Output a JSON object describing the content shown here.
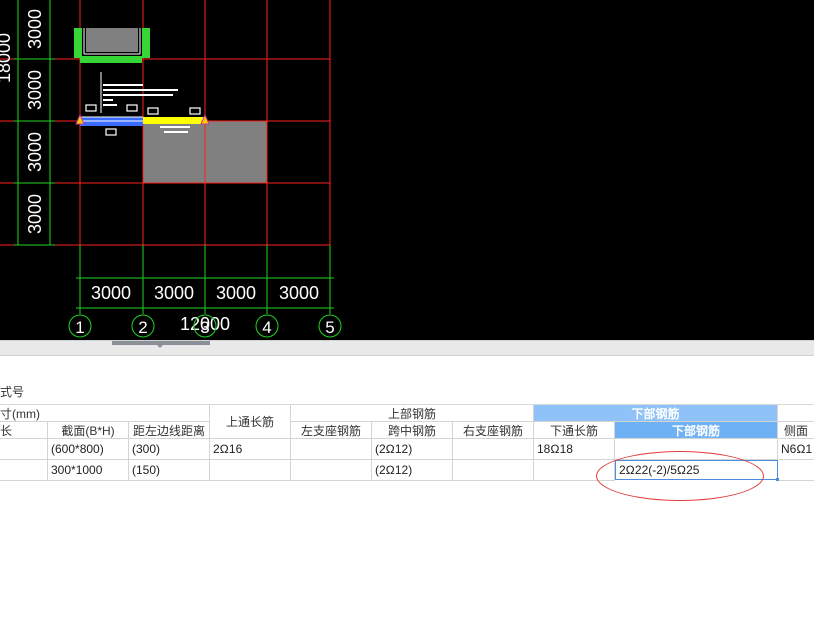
{
  "cad": {
    "left_dims": [
      "3000",
      "3000",
      "3000",
      "3000"
    ],
    "left_total": "18000",
    "bottom_dims": [
      "3000",
      "3000",
      "3000",
      "3000"
    ],
    "bottom_total": "12000",
    "axis_labels": [
      "1",
      "2",
      "3",
      "4",
      "5"
    ],
    "colors": {
      "grid": "#ff2020",
      "dim": "#1fd31f",
      "slab": "#808080",
      "beam_green": "#36d636",
      "beam_yellow": "#ffff00",
      "beam_blue": "#3a6bff"
    }
  },
  "table": {
    "title": "式号",
    "header1": {
      "size": "寸(mm)",
      "top_through": "上通长筋",
      "top_rebar": "上部钢筋",
      "bottom_rebar": "下部钢筋",
      "side": ""
    },
    "header2": {
      "length": "长",
      "section": "截面(B*H)",
      "left_dist": "距左边线距离",
      "left_support": "左支座钢筋",
      "mid_span": "跨中钢筋",
      "right_support": "右支座钢筋",
      "bottom_through": "下通长筋",
      "bottom_rebar": "下部钢筋",
      "side_rebar": "侧面"
    },
    "rows": [
      {
        "length": "",
        "section": "(600*800)",
        "left_dist": "(300)",
        "top_through": "2Ω16",
        "left_support": "",
        "mid_span": "(2Ω12)",
        "right_support": "",
        "bottom_through": "18Ω18",
        "bottom_rebar": "",
        "side_rebar": "N6Ω1"
      },
      {
        "length": "",
        "section": "300*1000",
        "left_dist": "(150)",
        "top_through": "",
        "left_support": "",
        "mid_span": "(2Ω12)",
        "right_support": "",
        "bottom_through": "",
        "bottom_rebar": "2Ω22(-2)/5Ω25",
        "side_rebar": ""
      }
    ]
  }
}
